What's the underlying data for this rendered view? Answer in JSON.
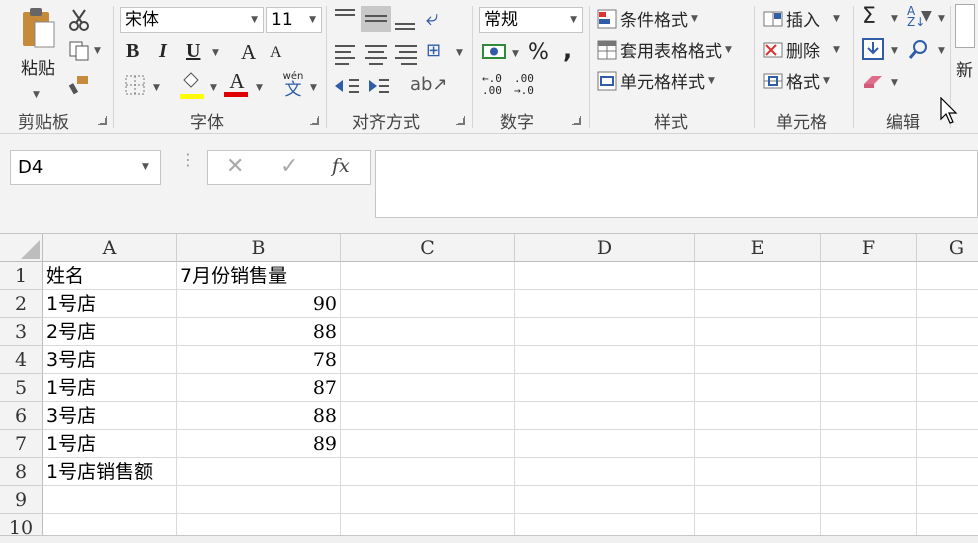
{
  "ribbon": {
    "clipboard": {
      "paste_label": "粘贴",
      "group_label": "剪贴板"
    },
    "font": {
      "font_name": "宋体",
      "font_size": "11",
      "group_label": "字体",
      "bold": "B",
      "italic": "I",
      "underline": "U",
      "grow": "A",
      "shrink": "A",
      "phonetic_top": "wén",
      "phonetic_bottom": "文"
    },
    "alignment": {
      "group_label": "对齐方式"
    },
    "number": {
      "format": "常规",
      "percent": "%",
      "comma": ",",
      "group_label": "数字"
    },
    "styles": {
      "conditional": "条件格式",
      "table_format": "套用表格格式",
      "cell_styles": "单元格样式",
      "group_label": "样式"
    },
    "cells": {
      "insert": "插入",
      "delete": "删除",
      "format": "格式",
      "group_label": "单元格"
    },
    "editing": {
      "sigma": "Σ",
      "group_label": "编辑"
    },
    "overflow_text": "新"
  },
  "formula_bar": {
    "name_box": "D4",
    "fx": "fx",
    "formula": ""
  },
  "columns": [
    "A",
    "B",
    "C",
    "D",
    "E",
    "F",
    "G"
  ],
  "rows": [
    {
      "num": "1",
      "a": "姓名",
      "b": "7月份销售量"
    },
    {
      "num": "2",
      "a": "1号店",
      "b": "90"
    },
    {
      "num": "3",
      "a": "2号店",
      "b": "88"
    },
    {
      "num": "4",
      "a": "3号店",
      "b": "78"
    },
    {
      "num": "5",
      "a": "1号店",
      "b": "87"
    },
    {
      "num": "6",
      "a": "3号店",
      "b": "88"
    },
    {
      "num": "7",
      "a": "1号店",
      "b": "89"
    },
    {
      "num": "8",
      "a": "1号店销售额",
      "b": ""
    },
    {
      "num": "9",
      "a": "",
      "b": ""
    },
    {
      "num": "10",
      "a": "",
      "b": ""
    }
  ],
  "colors": {
    "fill_color": "#ffff00",
    "font_color": "#e00000",
    "ribbon_bg": "#f3f3f3"
  }
}
